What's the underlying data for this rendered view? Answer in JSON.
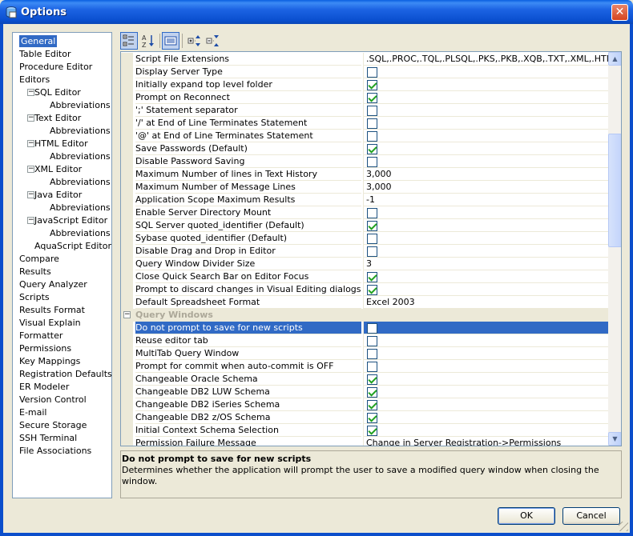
{
  "window": {
    "title": "Options",
    "close_label": "✕"
  },
  "tree": [
    {
      "label": "General",
      "indent": 0,
      "selected": true
    },
    {
      "label": "Table Editor",
      "indent": 0
    },
    {
      "label": "Procedure Editor",
      "indent": 0
    },
    {
      "label": "Editors",
      "indent": 0
    },
    {
      "label": "SQL Editor",
      "indent": 1,
      "expander": "−"
    },
    {
      "label": "Abbreviations",
      "indent": 2
    },
    {
      "label": "Text Editor",
      "indent": 1,
      "expander": "−"
    },
    {
      "label": "Abbreviations",
      "indent": 2
    },
    {
      "label": "HTML Editor",
      "indent": 1,
      "expander": "−"
    },
    {
      "label": "Abbreviations",
      "indent": 2
    },
    {
      "label": "XML Editor",
      "indent": 1,
      "expander": "−"
    },
    {
      "label": "Abbreviations",
      "indent": 2
    },
    {
      "label": "Java Editor",
      "indent": 1,
      "expander": "−"
    },
    {
      "label": "Abbreviations",
      "indent": 2
    },
    {
      "label": "JavaScript Editor",
      "indent": 1,
      "expander": "−"
    },
    {
      "label": "Abbreviations",
      "indent": 2
    },
    {
      "label": "AquaScript Editor",
      "indent": 1
    },
    {
      "label": "Compare",
      "indent": 0
    },
    {
      "label": "Results",
      "indent": 0
    },
    {
      "label": "Query Analyzer",
      "indent": 0
    },
    {
      "label": "Scripts",
      "indent": 0
    },
    {
      "label": "Results Format",
      "indent": 0
    },
    {
      "label": "Visual Explain",
      "indent": 0
    },
    {
      "label": "Formatter",
      "indent": 0
    },
    {
      "label": "Permissions",
      "indent": 0
    },
    {
      "label": "Key Mappings",
      "indent": 0
    },
    {
      "label": "Registration Defaults",
      "indent": 0
    },
    {
      "label": "ER Modeler",
      "indent": 0
    },
    {
      "label": "Version Control",
      "indent": 0
    },
    {
      "label": "E-mail",
      "indent": 0
    },
    {
      "label": "Secure Storage",
      "indent": 0
    },
    {
      "label": "SSH Terminal",
      "indent": 0
    },
    {
      "label": "File Associations",
      "indent": 0
    }
  ],
  "toolbar": [
    {
      "icon": "categorized-icon",
      "pressed": true
    },
    {
      "icon": "alphabetical-sort-icon",
      "pressed": false
    },
    {
      "icon": "property-pages-icon",
      "pressed": true
    },
    {
      "icon": "expand-all-icon",
      "pressed": false
    },
    {
      "icon": "collapse-all-icon",
      "pressed": false
    }
  ],
  "properties": [
    {
      "name": "Script File Extensions",
      "value": ".SQL,.PROC,.TQL,.PLSQL,.PKS,.PKB,.XQB,.TXT,.XML,.HTML"
    },
    {
      "name": "Display Server Type",
      "checkbox": false
    },
    {
      "name": "Initially expand top level folder",
      "checkbox": true
    },
    {
      "name": "Prompt on Reconnect",
      "checkbox": true
    },
    {
      "name": "';' Statement separator",
      "checkbox": false
    },
    {
      "name": "'/' at End of Line Terminates Statement",
      "checkbox": false
    },
    {
      "name": "'@' at End of Line Terminates Statement",
      "checkbox": false
    },
    {
      "name": "Save Passwords (Default)",
      "checkbox": true
    },
    {
      "name": "Disable Password Saving",
      "checkbox": false
    },
    {
      "name": "Maximum Number of lines in Text History",
      "value": "3,000"
    },
    {
      "name": "Maximum Number of Message Lines",
      "value": "3,000"
    },
    {
      "name": "Application Scope Maximum Results",
      "value": "-1"
    },
    {
      "name": "Enable Server Directory Mount",
      "checkbox": false
    },
    {
      "name": "SQL Server quoted_identifier (Default)",
      "checkbox": true
    },
    {
      "name": "Sybase quoted_identifier (Default)",
      "checkbox": false
    },
    {
      "name": "Disable Drag and Drop in Editor",
      "checkbox": false
    },
    {
      "name": "Query Window Divider Size",
      "value": "3"
    },
    {
      "name": "Close Quick Search Bar on Editor Focus",
      "checkbox": true
    },
    {
      "name": "Prompt to discard changes in Visual Editing dialogs",
      "checkbox": true
    },
    {
      "name": "Default Spreadsheet Format",
      "value": "Excel 2003"
    },
    {
      "category": "Query Windows"
    },
    {
      "name": "Do not prompt to save for new scripts",
      "checkbox": false,
      "highlight": true
    },
    {
      "name": "Reuse editor tab",
      "checkbox": false
    },
    {
      "name": "MultiTab Query Window",
      "checkbox": false
    },
    {
      "name": "Prompt for commit when auto-commit is OFF",
      "checkbox": false
    },
    {
      "name": "Changeable Oracle Schema",
      "checkbox": true
    },
    {
      "name": "Changeable DB2 LUW Schema",
      "checkbox": true
    },
    {
      "name": "Changeable DB2 iSeries Schema",
      "checkbox": true
    },
    {
      "name": "Changeable DB2 z/OS Schema",
      "checkbox": true
    },
    {
      "name": "Initial Context Schema Selection",
      "checkbox": true
    },
    {
      "name": "Permission Failure Message",
      "value": "Change in Server Registration->Permissions"
    }
  ],
  "description": {
    "title": "Do not prompt to save for new scripts",
    "text": "Determines whether the application will prompt the user to save a modified query window when closing the window."
  },
  "buttons": {
    "ok": "OK",
    "cancel": "Cancel"
  },
  "scrollbar": {
    "up": "▲",
    "down": "▼"
  }
}
